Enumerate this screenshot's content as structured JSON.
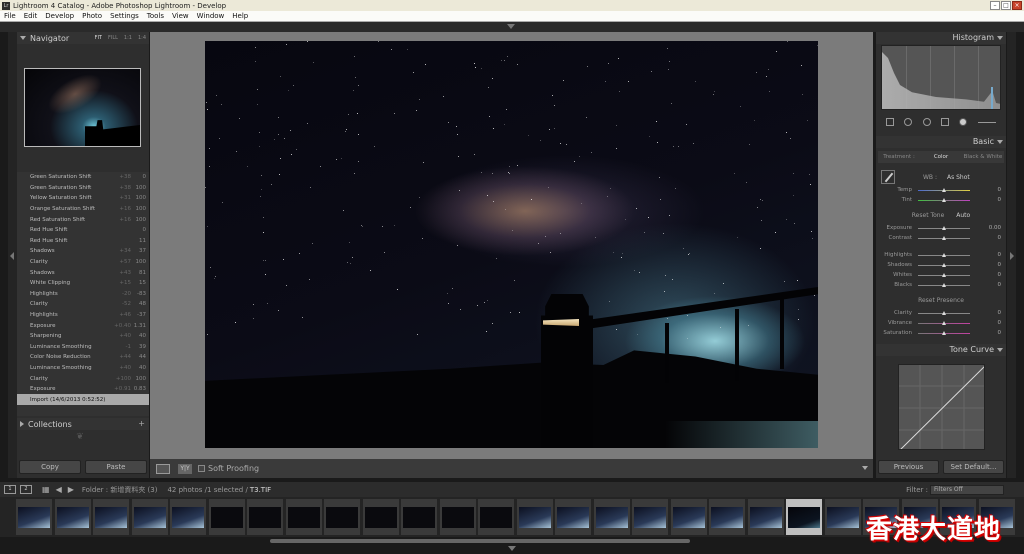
{
  "window": {
    "title": "Lightroom 4 Catalog - Adobe Photoshop Lightroom - Develop",
    "app_icon": "Lr"
  },
  "menu": [
    "File",
    "Edit",
    "Develop",
    "Photo",
    "Settings",
    "Tools",
    "View",
    "Window",
    "Help"
  ],
  "left_panel": {
    "navigator_title": "Navigator",
    "nav_options": [
      "FIT",
      "FILL",
      "1:1",
      "1:4"
    ],
    "history": [
      {
        "label": "Green Saturation Shift",
        "v1": "+38",
        "v2": "0"
      },
      {
        "label": "Green Saturation Shift",
        "v1": "+38",
        "v2": "100"
      },
      {
        "label": "Yellow Saturation Shift",
        "v1": "+31",
        "v2": "100"
      },
      {
        "label": "Orange Saturation Shift",
        "v1": "+16",
        "v2": "100"
      },
      {
        "label": "Red Saturation Shift",
        "v1": "+16",
        "v2": "100"
      },
      {
        "label": "Red Hue Shift",
        "v1": "",
        "v2": "0"
      },
      {
        "label": "Red Hue Shift",
        "v1": "",
        "v2": "11"
      },
      {
        "label": "Shadows",
        "v1": "+34",
        "v2": "37"
      },
      {
        "label": "Clarity",
        "v1": "+57",
        "v2": "100"
      },
      {
        "label": "Shadows",
        "v1": "+43",
        "v2": "81"
      },
      {
        "label": "White Clipping",
        "v1": "+15",
        "v2": "15"
      },
      {
        "label": "Highlights",
        "v1": "-20",
        "v2": "-83"
      },
      {
        "label": "Clarity",
        "v1": "-52",
        "v2": "48"
      },
      {
        "label": "Highlights",
        "v1": "+46",
        "v2": "-37"
      },
      {
        "label": "Exposure",
        "v1": "+0.40",
        "v2": "1.31"
      },
      {
        "label": "Sharpening",
        "v1": "+40",
        "v2": "40"
      },
      {
        "label": "Luminance Smoothing",
        "v1": "-1",
        "v2": "39"
      },
      {
        "label": "Color Noise Reduction",
        "v1": "+44",
        "v2": "44"
      },
      {
        "label": "Luminance Smoothing",
        "v1": "+40",
        "v2": "40"
      },
      {
        "label": "Clarity",
        "v1": "+100",
        "v2": "100"
      },
      {
        "label": "Exposure",
        "v1": "+0.91",
        "v2": "0.83"
      },
      {
        "label": "Import (14/6/2013 0:52:52)",
        "v1": "",
        "v2": ""
      }
    ],
    "collections_title": "Collections",
    "copy_label": "Copy",
    "paste_label": "Paste"
  },
  "toolbar": {
    "soft_proofing": "Soft Proofing"
  },
  "right_panel": {
    "histogram_title": "Histogram",
    "basic_title": "Basic",
    "treatment_label": "Treatment :",
    "treatment_color": "Color",
    "treatment_bw": "Black & White",
    "wb_label": "WB :",
    "wb_value": "As Shot",
    "temp_label": "Temp",
    "temp_value": "0",
    "tint_label": "Tint",
    "tint_value": "0",
    "tone_label": "Reset Tone",
    "auto_label": "Auto",
    "exposure_label": "Exposure",
    "exposure_value": "0.00",
    "contrast_label": "Contrast",
    "contrast_value": "0",
    "highlights_label": "Highlights",
    "highlights_value": "0",
    "shadows_label": "Shadows",
    "shadows_value": "0",
    "whites_label": "Whites",
    "whites_value": "0",
    "blacks_label": "Blacks",
    "blacks_value": "0",
    "presence_label": "Reset Presence",
    "clarity_label": "Clarity",
    "clarity_value": "0",
    "vibrance_label": "Vibrance",
    "vibrance_value": "0",
    "saturation_label": "Saturation",
    "saturation_value": "0",
    "tonecurve_title": "Tone Curve",
    "previous_label": "Previous",
    "setdefault_label": "Set Default..."
  },
  "filmstrip": {
    "folder_label": "Folder : 新增資料夾 (3)",
    "count_label": "42 photos /1 selected /",
    "filename": "T3.TIF",
    "filter_label": "Filter :",
    "filter_value": "Filters Off"
  },
  "watermark": "香港大道地"
}
